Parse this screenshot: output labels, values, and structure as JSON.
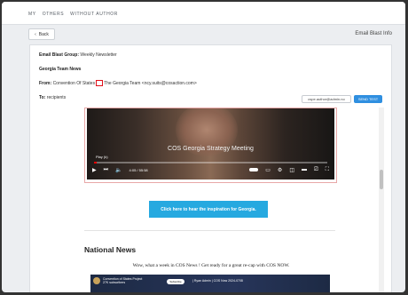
{
  "nav": {
    "breadcrumb": [
      "MY",
      "OTHERS",
      "WITHOUT AUTHOR"
    ]
  },
  "subbar": {
    "back_label": "Back",
    "info_title": "Email Blast Info"
  },
  "details": {
    "group_label": "Email Blast Group:",
    "group_value": "Weekly Newsletter",
    "team": "Georgia Team News",
    "from_label": "From:",
    "from_prefix": "Convention Of States",
    "from_suffix": "The Georgia Team <ncy.suits@cosaction.com>",
    "to_label": "To:",
    "to_value": "recipients",
    "email_button": "cspe.author@admin.no",
    "send_button": "SEND TEST"
  },
  "video": {
    "title": "COS Georgia Strategy Meeting",
    "play_label": "Play (k)",
    "time": "4:05 / 55:58",
    "progress": 0.01
  },
  "cta_label": "Click here to hear the inspiration for Georgia.",
  "news": {
    "heading": "National News",
    "intro": "Wow, what a week in COS News !  Get ready for a great re-cap with COS NOW.",
    "thumb_channel": "Convention of States Project",
    "thumb_channel_sub": "27K subscribers",
    "thumb_subscribe": "Subscribe",
    "thumb_title": "| Ryan Admin | COS Now 2024-0708"
  },
  "colors": {
    "accent": "#2f8fe0",
    "cta": "#26a9e0",
    "highlight": "#e0101a"
  }
}
